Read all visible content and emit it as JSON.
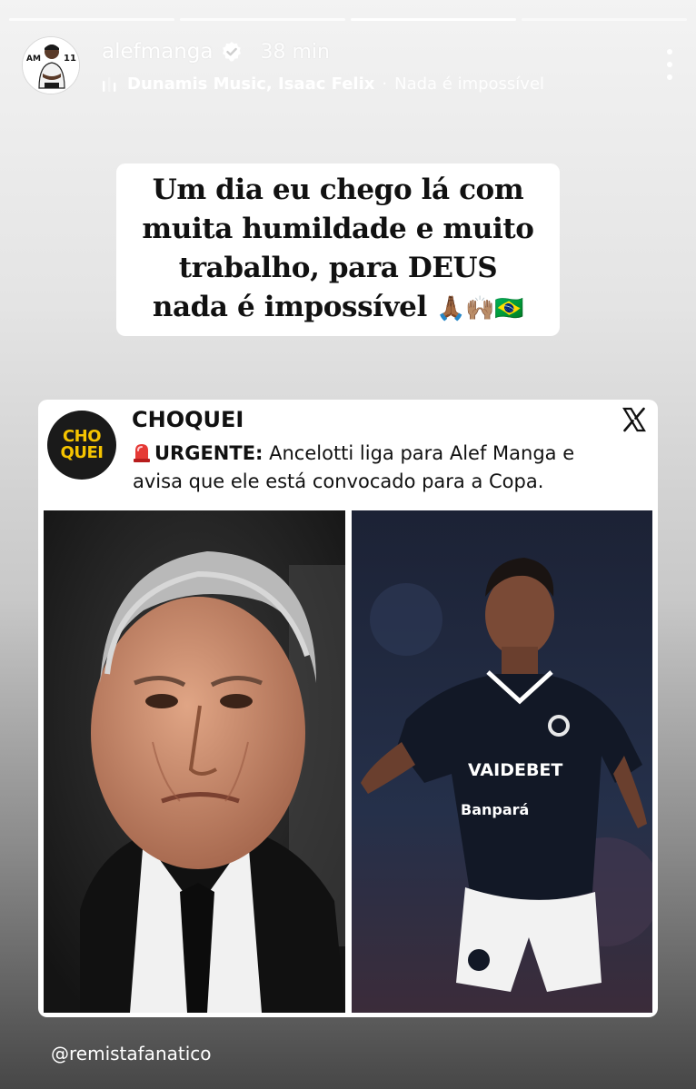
{
  "story": {
    "progress_segments": 4,
    "active_segment": 3
  },
  "header": {
    "username": "alefmanga",
    "time": "38 min",
    "music_artist": "Dunamis Music, Isaac Felix",
    "music_separator": "·",
    "music_song": "Nada é impossível",
    "avatar_text": "AM",
    "avatar_number": "11"
  },
  "caption": {
    "lines": [
      "Um dia eu chego lá com",
      "muita humildade e muito",
      "trabalho, para DEUS",
      "nada é impossível"
    ],
    "emojis": "🙏🏾🙌🏽🇧🇷"
  },
  "post": {
    "logo_top": "CHO",
    "logo_bottom": "QUEI",
    "source": "CHOQUEI",
    "urgent_label": "URGENTE:",
    "headline_line1": " Ancelotti liga para Alef Manga e",
    "headline_line2": "avisa que ele está convocado para a Copa.",
    "jersey_sponsor": "VAIDEBET",
    "jersey_sponsor2": "Banpará"
  },
  "footer": {
    "mention": "@remistafanatico"
  },
  "colors": {
    "logo_yellow": "#f5c400",
    "logo_bg": "#1a1a1a",
    "siren_red": "#e53935",
    "verified_blue": "#ffffff"
  }
}
